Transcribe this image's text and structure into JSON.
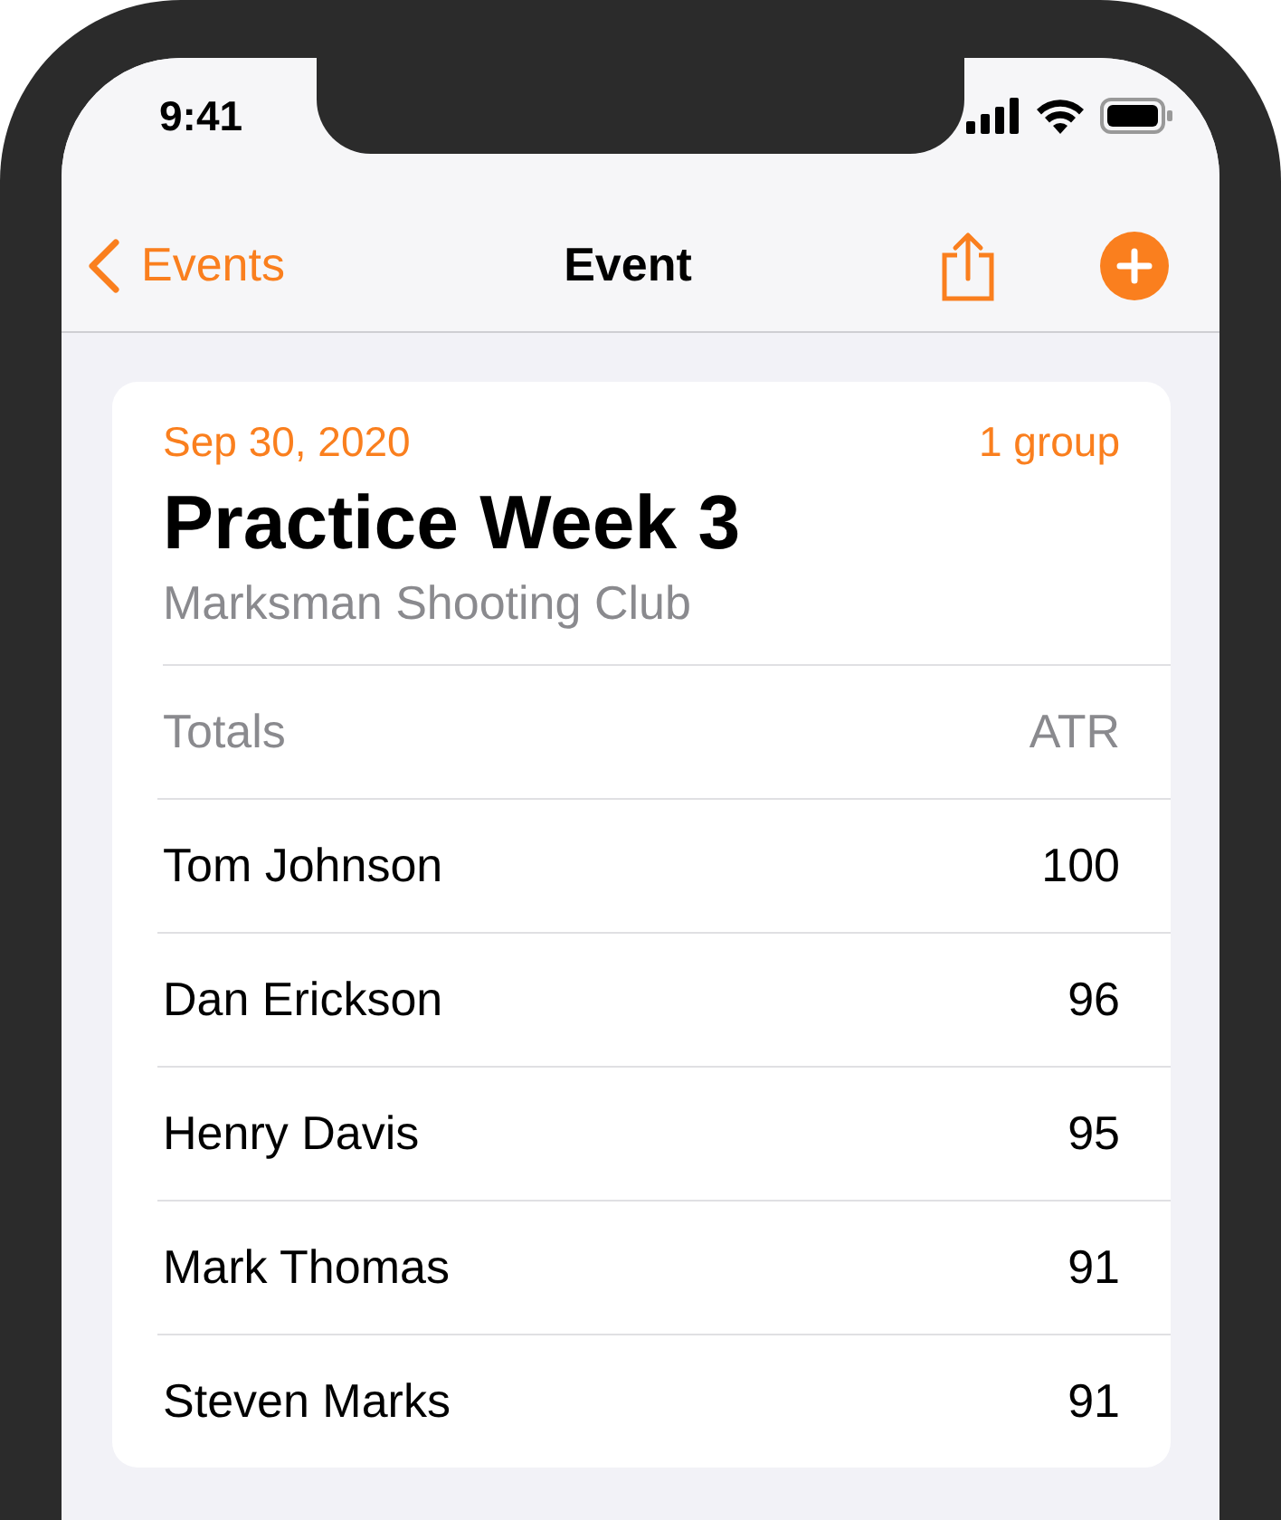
{
  "status_bar": {
    "time": "9:41"
  },
  "nav_bar": {
    "back": "Events",
    "title": "Event"
  },
  "event": {
    "date": "Sep 30, 2020",
    "groups": "1 group",
    "title": "Practice Week 3",
    "club": "Marksman Shooting Club"
  },
  "table": {
    "header": {
      "label": "Totals",
      "column": "ATR"
    },
    "rows": [
      {
        "name": "Tom Johnson",
        "score": "100"
      },
      {
        "name": "Dan Erickson",
        "score": "96"
      },
      {
        "name": "Henry Davis",
        "score": "95"
      },
      {
        "name": "Mark Thomas",
        "score": "91"
      },
      {
        "name": "Steven Marks",
        "score": "91"
      }
    ]
  }
}
